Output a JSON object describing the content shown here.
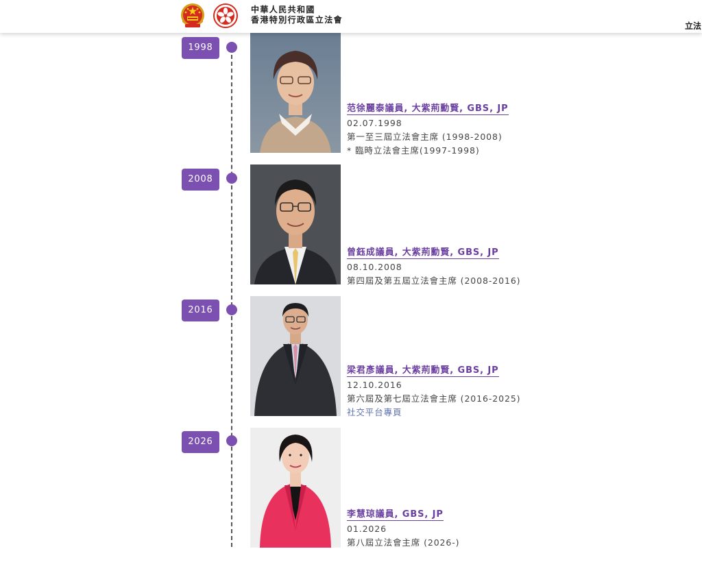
{
  "header": {
    "title_line1": "中華人民共和國",
    "title_line2": "香港特別行政區立法會",
    "nav_partial": "立法"
  },
  "icons": {
    "prc_emblem": "national-emblem-icon",
    "hk_emblem": "hksar-regional-emblem-icon"
  },
  "colors": {
    "accent": "#7b50b0",
    "name_link": "#6a3fa0",
    "text": "#444444",
    "social_link": "#5b6fae"
  },
  "timeline": [
    {
      "year": "1998",
      "name": "范徐麗泰議員, 大紫荊勳賢, GBS, JP",
      "date": "02.07.1998",
      "term": "第一至三屆立法會主席 (1998-2008)",
      "note": "* 臨時立法會主席(1997-1998)"
    },
    {
      "year": "2008",
      "name": "曾鈺成議員, 大紫荊勳賢, GBS, JP",
      "date": "08.10.2008",
      "term": "第四屆及第五屆立法會主席 (2008-2016)"
    },
    {
      "year": "2016",
      "name": "梁君彥議員, 大紫荊勳賢, GBS, JP",
      "date": "12.10.2016",
      "term": "第六屆及第七屆立法會主席 (2016-2025)",
      "link": "社交平台專頁"
    },
    {
      "year": "2026",
      "name": "李慧琼議員, GBS, JP",
      "date": "01.2026",
      "term": "第八屆立法會主席 (2026-)"
    }
  ]
}
